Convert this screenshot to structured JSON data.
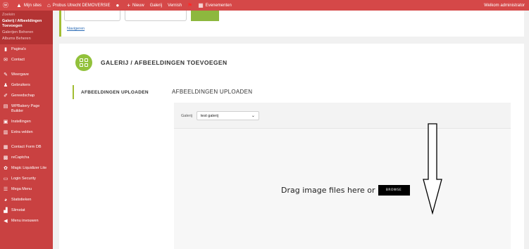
{
  "admin_bar": {
    "wp_logo_icon": "wordpress-icon",
    "my_sites": "Mijn sites",
    "site_name": "Probus Utrecht DEMOVERSIE",
    "comments_icon": "comment-icon",
    "new_label": "Nieuw",
    "gallery_label": "Galerij",
    "clear_label": "Vernish",
    "events_label": "Evenementen",
    "greeting": "Welkom administrator"
  },
  "sidebar": {
    "search_overflow": "Zoekén",
    "submenu": [
      {
        "label": "Galerij / Afbeeldingen Toevoegen",
        "current": true
      },
      {
        "label": "Galerijen Beheren",
        "current": false
      },
      {
        "label": "Albums Beheren",
        "current": false
      }
    ],
    "items": [
      {
        "label": "Pagina's",
        "icon": "page-icon"
      },
      {
        "label": "Contact",
        "icon": "mail-icon"
      },
      {
        "label": "Weergave",
        "icon": "brush-icon"
      },
      {
        "label": "Gebruikers",
        "icon": "user-icon"
      },
      {
        "label": "Gereedschap",
        "icon": "wrench-icon"
      },
      {
        "label": "WPBakery Page Builder",
        "icon": "builder-icon"
      },
      {
        "label": "Instellingen",
        "icon": "settings-icon"
      },
      {
        "label": "Extra velden",
        "icon": "fields-icon"
      },
      {
        "label": "Contact Form DB",
        "icon": "database-icon"
      },
      {
        "label": "reCaptcha",
        "icon": "captcha-icon"
      },
      {
        "label": "Magic Liquidizer Lite",
        "icon": "gear-icon"
      },
      {
        "label": "Login Security",
        "icon": "lock-icon"
      },
      {
        "label": "Mega Menu",
        "icon": "menu-icon"
      },
      {
        "label": "Statistieken",
        "icon": "stats-icon"
      },
      {
        "label": "Slimstat",
        "icon": "chart-icon"
      },
      {
        "label": "Menu invouwen",
        "icon": "collapse-icon"
      }
    ]
  },
  "top_box": {
    "link": "Navigeren"
  },
  "panel": {
    "title": "GALERIJ / AFBEELDINGEN TOEVOEGEN",
    "tab_label": "AFBEELDINGEN UPLOADEN",
    "section_title": "AFBEELDINGEN UPLOADEN",
    "gallery_label": "Galerij",
    "gallery_selected": "test galerij",
    "drop_text": "Drag image files here or",
    "browse_label": "BROWSE"
  },
  "colors": {
    "admin_bar": "#d54848",
    "sidebar": "#c94141",
    "accent_green": "#92c13b"
  }
}
